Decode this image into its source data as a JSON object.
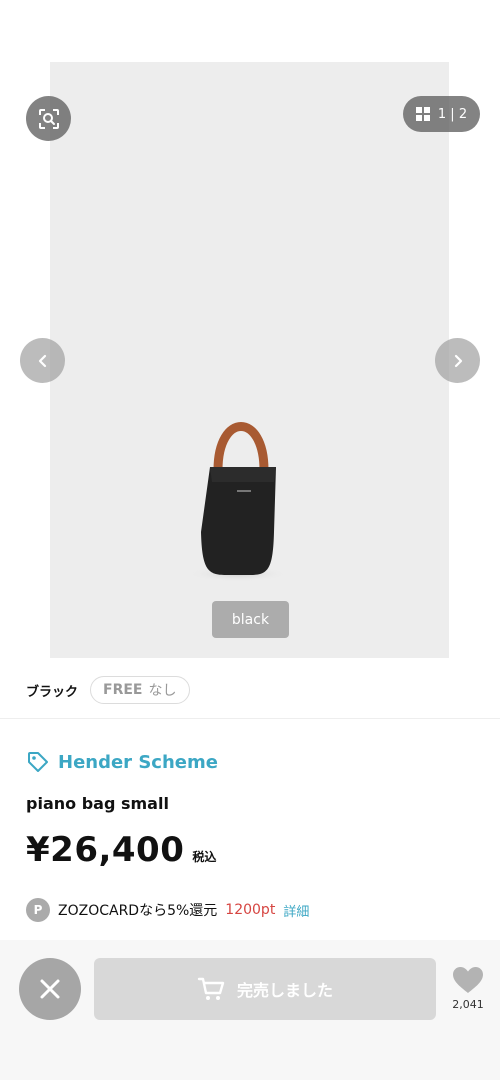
{
  "gallery": {
    "counter_current": "1",
    "counter_separator": "|",
    "counter_total": "2",
    "color_label": "black",
    "icons": [
      "image-search-icon",
      "grid-icon",
      "chevron-left-icon",
      "chevron-right-icon"
    ]
  },
  "variant": {
    "color": "ブラック",
    "size": "FREE",
    "stock": "なし"
  },
  "product": {
    "brand": "Hender Scheme",
    "name": "piano bag small",
    "price": "¥26,400",
    "tax_label": "税込"
  },
  "points": {
    "badge": "P",
    "text": "ZOZOCARDなら5%還元",
    "amount": "1200pt",
    "link": "詳細"
  },
  "bottom": {
    "cart_label": "完売しました",
    "fav_count": "2,041"
  },
  "colors": {
    "accent": "#3ca7c4",
    "points_red": "#d64541",
    "disabled_button": "#d8d8d8",
    "overlay_gray": "#5a5a5a"
  }
}
